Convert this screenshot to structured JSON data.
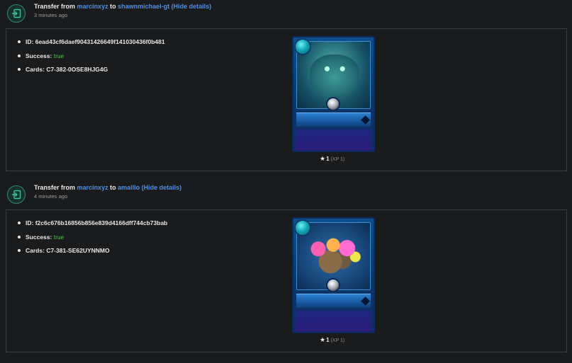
{
  "transfers": [
    {
      "title_prefix": "Transfer from",
      "from_user": "marcinxyz",
      "to_word": "to",
      "to_user": "shawnmichael-gt",
      "paren_open": "(",
      "hide_details": "Hide details",
      "paren_close": ")",
      "time_ago": "3 minutes ago",
      "id_label": "ID:",
      "id_value": "6ead43cf6daef90431426649f141030436f0b481",
      "success_label": "Success:",
      "success_value": "true",
      "cards_label": "Cards:",
      "cards_value": "C7-382-0OSE8HJG4G",
      "card_level": "1",
      "card_xp": "(XP 1)",
      "card_art": "teal sea monster art"
    },
    {
      "title_prefix": "Transfer from",
      "from_user": "marcinxyz",
      "to_word": "to",
      "to_user": "amaillo",
      "paren_open": "(",
      "hide_details": "Hide details",
      "paren_close": ")",
      "time_ago": "4 minutes ago",
      "id_label": "ID:",
      "id_value": "f2c6c676b16856b856e839d4166dff744cb73bab",
      "success_label": "Success:",
      "success_value": "true",
      "cards_label": "Cards:",
      "cards_value": "C7-381-SE62UYNNMO",
      "card_level": "1",
      "card_xp": "(XP 1)",
      "card_art": "coral flower art"
    }
  ],
  "colors": {
    "link": "#4d8fe0",
    "success_true": "#4cc04c",
    "icon_ring": "#2a8a74",
    "panel_border": "#3b3c3f",
    "background": "#1a1b1d"
  },
  "icons": {
    "transfer": "transfer-arrow-icon",
    "bullet": "bullet-icon",
    "star": "star-icon"
  }
}
